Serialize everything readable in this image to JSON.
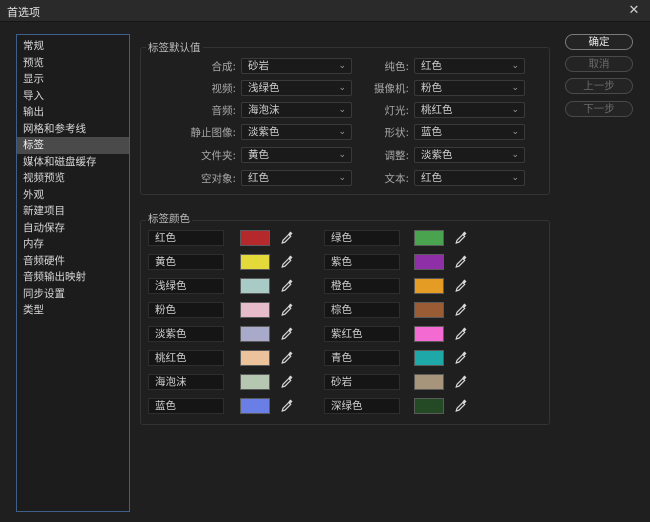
{
  "window": {
    "title": "首选项",
    "close_glyph": "✕"
  },
  "sidebar": {
    "items": [
      {
        "label": "常规"
      },
      {
        "label": "预览"
      },
      {
        "label": "显示"
      },
      {
        "label": "导入"
      },
      {
        "label": "输出"
      },
      {
        "label": "网格和参考线"
      },
      {
        "label": "标签",
        "active": true
      },
      {
        "label": "媒体和磁盘缓存"
      },
      {
        "label": "视频预览"
      },
      {
        "label": "外观"
      },
      {
        "label": "新建项目"
      },
      {
        "label": "自动保存"
      },
      {
        "label": "内存"
      },
      {
        "label": "音频硬件"
      },
      {
        "label": "音频输出映射"
      },
      {
        "label": "同步设置"
      },
      {
        "label": "类型"
      }
    ]
  },
  "defaults": {
    "title": "标签默认值",
    "left": [
      {
        "label": "合成:",
        "value": "砂岩"
      },
      {
        "label": "视频:",
        "value": "浅绿色"
      },
      {
        "label": "音频:",
        "value": "海泡沫"
      },
      {
        "label": "静止图像:",
        "value": "淡紫色"
      },
      {
        "label": "文件夹:",
        "value": "黄色"
      },
      {
        "label": "空对象:",
        "value": "红色"
      }
    ],
    "right": [
      {
        "label": "纯色:",
        "value": "红色"
      },
      {
        "label": "摄像机:",
        "value": "粉色"
      },
      {
        "label": "灯光:",
        "value": "桃红色"
      },
      {
        "label": "形状:",
        "value": "蓝色"
      },
      {
        "label": "调整:",
        "value": "淡紫色"
      },
      {
        "label": "文本:",
        "value": "红色"
      }
    ]
  },
  "colors": {
    "title": "标签颜色",
    "left": [
      {
        "name": "红色",
        "hex": "#b5282c"
      },
      {
        "name": "黄色",
        "hex": "#e4d93a"
      },
      {
        "name": "浅绿色",
        "hex": "#a9cbc6"
      },
      {
        "name": "粉色",
        "hex": "#e6bccb"
      },
      {
        "name": "淡紫色",
        "hex": "#a9a9ca"
      },
      {
        "name": "桃红色",
        "hex": "#ecc29d"
      },
      {
        "name": "海泡沫",
        "hex": "#b5c7b1"
      },
      {
        "name": "蓝色",
        "hex": "#6a7fe6"
      }
    ],
    "right": [
      {
        "name": "绿色",
        "hex": "#4aa44f"
      },
      {
        "name": "紫色",
        "hex": "#8e2fa8"
      },
      {
        "name": "橙色",
        "hex": "#e49c25"
      },
      {
        "name": "棕色",
        "hex": "#9a5c34"
      },
      {
        "name": "紫红色",
        "hex": "#f26ad2"
      },
      {
        "name": "青色",
        "hex": "#1ea8a8"
      },
      {
        "name": "砂岩",
        "hex": "#a6957a"
      },
      {
        "name": "深绿色",
        "hex": "#234a24"
      }
    ]
  },
  "buttons": {
    "ok": "确定",
    "cancel": "取消",
    "prev": "上一步",
    "next": "下一步"
  },
  "icons": {
    "dropdown": "chevron-down-icon",
    "picker": "eyedropper-icon",
    "close": "close-icon"
  }
}
